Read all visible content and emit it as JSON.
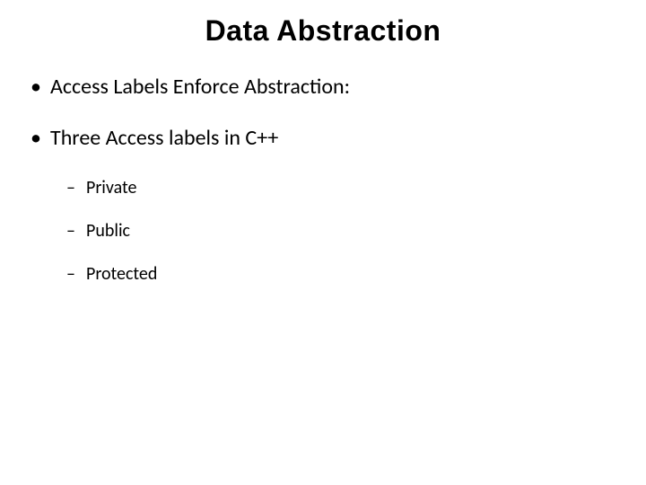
{
  "title": "Data Abstraction",
  "bullets": [
    {
      "text": "Access Labels Enforce Abstraction:"
    },
    {
      "text": "Three Access labels in C++"
    }
  ],
  "sub_bullets": [
    {
      "text": "Private"
    },
    {
      "text": "Public"
    },
    {
      "text": "Protected"
    }
  ]
}
